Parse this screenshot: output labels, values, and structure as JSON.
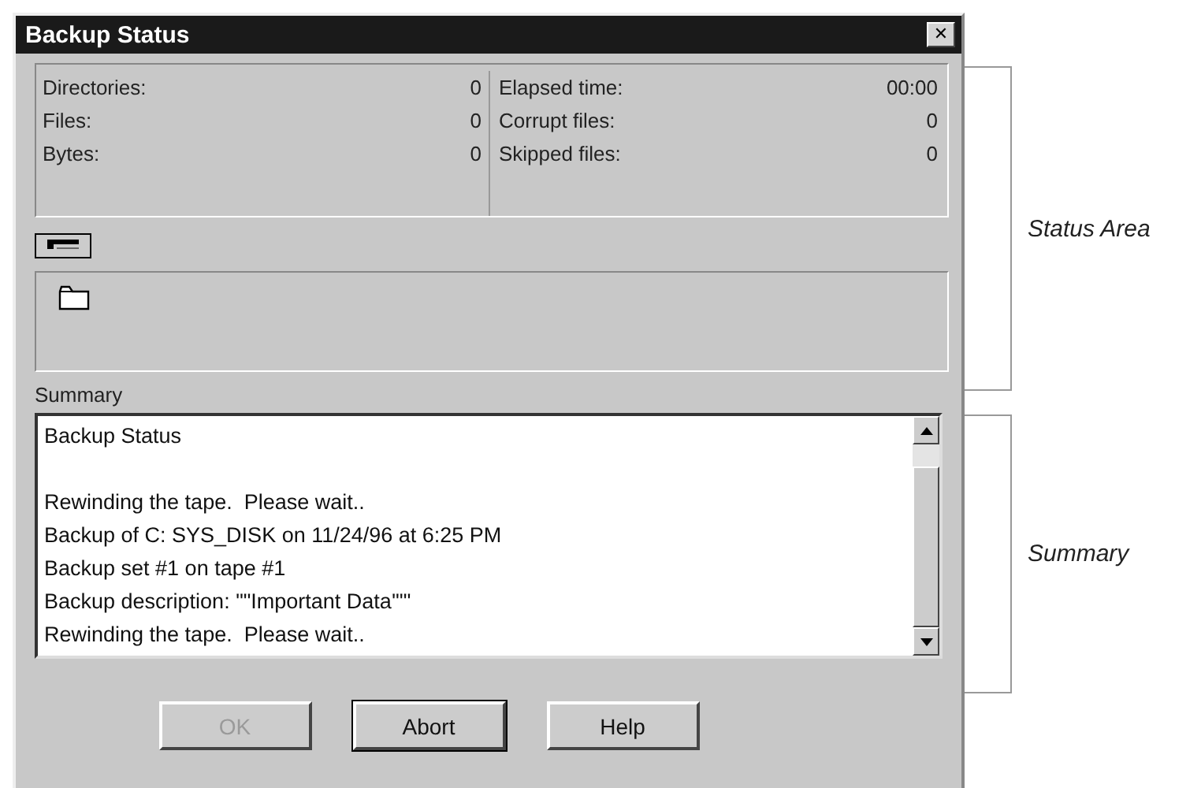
{
  "window": {
    "title": "Backup Status",
    "close": "✕"
  },
  "status": {
    "left": [
      {
        "label": "Directories:",
        "value": "0"
      },
      {
        "label": "Files:",
        "value": "0"
      },
      {
        "label": "Bytes:",
        "value": "0"
      }
    ],
    "right": [
      {
        "label": "Elapsed time:",
        "value": "00:00"
      },
      {
        "label": "Corrupt files:",
        "value": "0"
      },
      {
        "label": "Skipped files:",
        "value": "0"
      }
    ]
  },
  "summary": {
    "label": "Summary",
    "paragraphs": [
      [
        "Backup Status"
      ],
      [
        "Rewinding the tape.  Please wait..",
        "Backup of C: SYS_DISK on 11/24/96 at 6:25 PM",
        "Backup set #1 on tape #1",
        "Backup description: \"\"Important Data'\"\"",
        "Rewinding the tape.  Please wait.."
      ]
    ]
  },
  "buttons": [
    {
      "label": "OK",
      "disabled": true,
      "default": false
    },
    {
      "label": "Abort",
      "disabled": false,
      "default": true
    },
    {
      "label": "Help",
      "disabled": false,
      "default": false
    }
  ],
  "annotations": [
    {
      "label": "Status Area"
    },
    {
      "label": "Summary"
    }
  ]
}
